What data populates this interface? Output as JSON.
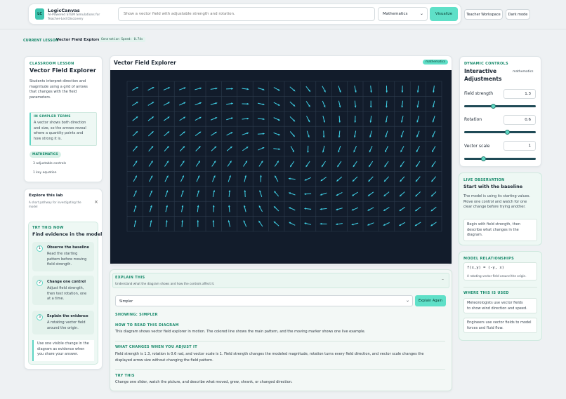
{
  "app": {
    "logo": "LC",
    "title": "LogicCanvas",
    "subtitle_line1": "AI-Powered STEM Simulations for",
    "subtitle_line2": "Teacher-Led Discovery"
  },
  "search": {
    "placeholder": "Show a vector field with adjustable strength and rotation.",
    "subject": "Mathematics",
    "visualize_label": "Visualize"
  },
  "header_buttons": {
    "teacher_workspace": "Teacher Workspace",
    "dark_mode": "Dark mode"
  },
  "lesson_bar": {
    "label": "CURRENT LESSON",
    "name": "Vector Field Explorer",
    "speed": "Generation Speed: 0.74s"
  },
  "left_card": {
    "label": "CLASSROOM LESSON",
    "title": "Vector Field Explorer",
    "desc": [
      "Students interpret direction and",
      "magnitude using a grid of arrows",
      "that changes with the field",
      "parameters."
    ],
    "simpler_label": "IN SIMPLER TERMS",
    "simpler_text": [
      "A vector shows both direction",
      "and size, so the arrows reveal",
      "where a quantity points and",
      "how strong it is."
    ],
    "subject_badge": "MATHEMATICS",
    "controls_count": "3 adjustable controls",
    "equation_count": "1 key equation"
  },
  "explore": {
    "title": "Explore this lab",
    "subtitle": [
      "A short pathway for investigating the",
      "model"
    ],
    "close": "×",
    "try_label": "TRY THIS NOW",
    "try_title": "Find evidence in the model",
    "steps": [
      {
        "num": "1",
        "title": "Observe the baseline",
        "text": [
          "Read the starting",
          "pattern before moving",
          "field strength."
        ]
      },
      {
        "num": "2",
        "title": "Change one control",
        "text": [
          "Adjust field strength,",
          "then test rotation, one",
          "at a time."
        ]
      },
      {
        "num": "3",
        "title": "Explain the evidence",
        "text": [
          "A rotating vector field",
          "around the origin."
        ]
      }
    ],
    "tip": [
      "Use one visible change in the",
      "diagram as evidence when",
      "you share your answer."
    ]
  },
  "viz": {
    "title": "Vector Field Explorer",
    "badge": "mathematics"
  },
  "explain": {
    "label": "EXPLAIN THIS",
    "subtitle": "Understand what the diagram shows and how the controls affect it.",
    "toggle": "–",
    "level": "Simpler",
    "button": "Explain Again",
    "showing": "SHOWING: SIMPLER",
    "sections": [
      {
        "label": "HOW TO READ THIS DIAGRAM",
        "text": [
          "This diagram shows vector field explorer in motion. The colored line shows the main pattern, and the moving marker shows one live example."
        ]
      },
      {
        "label": "WHAT CHANGES WHEN YOU ADJUST IT",
        "text": [
          "Field strength is 1.3, rotation is 0.6 rad, and vector scale is 1. Field strength changes the modeled magnitude, rotation turns every field direction, and vector scale changes the",
          "displayed arrow size without changing the field pattern."
        ]
      },
      {
        "label": "TRY THIS",
        "text": [
          "Change one slider, watch the picture, and describe what moved, grew, shrank, or changed direction."
        ]
      }
    ]
  },
  "controls": {
    "label": "DYNAMIC CONTROLS",
    "title_line1": "Interactive",
    "title_line2": "Adjustments",
    "badge": "mathematics",
    "items": [
      {
        "name": "Field strength",
        "value": "1.3",
        "fraction": 0.41
      },
      {
        "name": "Rotation",
        "value": "0.6",
        "fraction": 0.6
      },
      {
        "name": "Vector scale",
        "value": "1",
        "fraction": 0.27
      }
    ]
  },
  "observation": {
    "label": "LIVE OBSERVATION",
    "title": "Start with the baseline",
    "text": [
      "The model is using its starting values.",
      "Move one control and watch for one",
      "clear change before trying another."
    ],
    "hint": [
      "Begin with field strength, then",
      "describe what changes in the",
      "diagram."
    ]
  },
  "relationships": {
    "label": "MODEL RELATIONSHIPS",
    "equation": "f(x,y) = (-y, x)",
    "equation_desc": "A rotating vector field around the origin.",
    "used_label": "WHERE THIS IS USED",
    "uses": [
      [
        "Meteorologists use vector fields",
        "to show wind direction and speed."
      ],
      [
        "Engineers use vector fields to model",
        "forces and fluid flow."
      ]
    ]
  },
  "colors": {
    "accent": "#5fd6c4",
    "canvas": "#121c2b",
    "arrow": "#3fd0e6",
    "grid": "#2c3b4d"
  }
}
